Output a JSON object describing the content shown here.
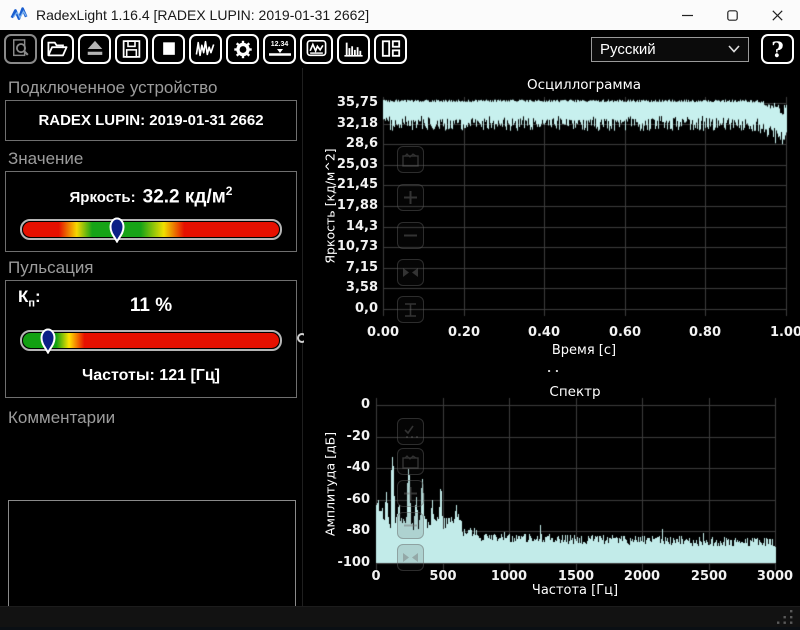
{
  "window": {
    "title": "RadexLight 1.16.4 [RADEX LUPIN: 2019-01-31 2662]"
  },
  "toolbar": {
    "buttons": [
      {
        "name": "find-device",
        "icon": "magnifier-document-icon",
        "disabled": true
      },
      {
        "name": "open-file",
        "icon": "open-folder-icon",
        "disabled": false
      },
      {
        "name": "eject-device",
        "icon": "eject-icon",
        "disabled": false
      },
      {
        "name": "save",
        "icon": "floppy-disk-icon",
        "disabled": false
      },
      {
        "name": "stop",
        "icon": "stop-square-icon",
        "disabled": false
      },
      {
        "name": "record-waveform",
        "icon": "waveform-icon",
        "disabled": false
      },
      {
        "name": "settings",
        "icon": "gear-icon",
        "disabled": false
      },
      {
        "name": "value-display-view",
        "icon": "digits-display-icon",
        "disabled": false
      },
      {
        "name": "oscillogram-view",
        "icon": "line-chart-icon",
        "disabled": false
      },
      {
        "name": "spectrum-view",
        "icon": "bar-chart-icon",
        "disabled": false
      },
      {
        "name": "layout-view",
        "icon": "layout-panels-icon",
        "disabled": false
      }
    ],
    "value_display_text": "12.34",
    "language": {
      "value": "Русский"
    },
    "help_label": "?"
  },
  "device_panel": {
    "heading": "Подключенное устройство",
    "device": "RADEX LUPIN: 2019-01-31 2662"
  },
  "value_panel": {
    "heading": "Значение",
    "label": "Яркость:",
    "value": "32.2",
    "unit": "кд/м",
    "unit_exp": "2",
    "marker_percent": 37
  },
  "pulsation_panel": {
    "heading": "Пульсация",
    "kp_main": "К",
    "kp_sub": "п",
    "kp_colon": ":",
    "kp_value": "11 %",
    "marker_percent": 10,
    "frequency_text": "Частоты: 121 [Гц]"
  },
  "comments_panel": {
    "heading": "Комментарии",
    "value": ""
  },
  "statusbar": {
    "text": ""
  },
  "chart_data": [
    {
      "id": "oscillogram",
      "type": "line",
      "title": "Осциллограмма",
      "xlabel": "Время [с]",
      "ylabel": "Яркость [кд/м^2]",
      "xlim": [
        0,
        1.0
      ],
      "ylim": [
        0,
        35.75
      ],
      "grid": true,
      "xticks": [
        {
          "v": 0.0,
          "label": "0.00"
        },
        {
          "v": 0.2,
          "label": "0.20"
        },
        {
          "v": 0.4,
          "label": "0.40"
        },
        {
          "v": 0.6,
          "label": "0.60"
        },
        {
          "v": 0.8,
          "label": "0.80"
        },
        {
          "v": 1.0,
          "label": "1.00"
        }
      ],
      "yticks": [
        {
          "v": 35.75,
          "label": "35,75"
        },
        {
          "v": 32.18,
          "label": "32,18"
        },
        {
          "v": 28.6,
          "label": "28,6"
        },
        {
          "v": 25.03,
          "label": "25,03"
        },
        {
          "v": 21.45,
          "label": "21,45"
        },
        {
          "v": 17.88,
          "label": "17,88"
        },
        {
          "v": 14.3,
          "label": "14,3"
        },
        {
          "v": 10.73,
          "label": "10,73"
        },
        {
          "v": 7.15,
          "label": "7,15"
        },
        {
          "v": 3.58,
          "label": "3,58"
        },
        {
          "v": 0.0,
          "label": "0,0"
        }
      ],
      "signal": {
        "description": "dense pulsating luminance waveform, mean ~32 kd/m^2, peaks clipped near 36.3, troughs 30.9-33.1, amplitude decays over last 9% of window down to ~27.6",
        "top_level": 36.35,
        "top_jitter": 0.45,
        "bottom_level": 30.9,
        "bottom_jitter": 2.2,
        "short_column_chance": 0.18,
        "decay_start_t": 0.905,
        "decay_bottom": 3.3,
        "decay_top": 2.6,
        "columns": 403,
        "seed": 20190131
      },
      "series_color": "#c7f0ee"
    },
    {
      "id": "spectrum",
      "type": "area",
      "title": "Спектр",
      "xlabel": "Частота [Гц]",
      "ylabel": "Амплитуда [дБ]",
      "xlim": [
        0,
        3000
      ],
      "ylim": [
        -100,
        0
      ],
      "grid": true,
      "xticks": [
        {
          "v": 0,
          "label": "0"
        },
        {
          "v": 500,
          "label": "500"
        },
        {
          "v": 1000,
          "label": "1000"
        },
        {
          "v": 1500,
          "label": "1500"
        },
        {
          "v": 2000,
          "label": "2000"
        },
        {
          "v": 2500,
          "label": "2500"
        },
        {
          "v": 3000,
          "label": "3000"
        }
      ],
      "yticks": [
        {
          "v": 0,
          "label": "0"
        },
        {
          "v": -20,
          "label": "-20"
        },
        {
          "v": -40,
          "label": "-40"
        },
        {
          "v": -60,
          "label": "-60"
        },
        {
          "v": -80,
          "label": "-80"
        },
        {
          "v": -100,
          "label": "-100"
        }
      ],
      "peaks": [
        {
          "f": 15,
          "db": -60
        },
        {
          "f": 45,
          "db": -65
        },
        {
          "f": 75,
          "db": -55
        },
        {
          "f": 121,
          "db": -33
        },
        {
          "f": 170,
          "db": -62
        },
        {
          "f": 242,
          "db": -40
        },
        {
          "f": 300,
          "db": -58
        },
        {
          "f": 345,
          "db": -47
        },
        {
          "f": 420,
          "db": -60
        },
        {
          "f": 484,
          "db": -52
        },
        {
          "f": 600,
          "db": -63
        }
      ],
      "noise_floor": {
        "low_band_until_hz": 640,
        "low_band_db": -69,
        "low_band_jitter": 10,
        "high_band_db": -83,
        "high_band_slope_db": -4,
        "high_band_jitter": 6,
        "seed": 2662
      },
      "series_color": "#c2ebe9"
    }
  ]
}
